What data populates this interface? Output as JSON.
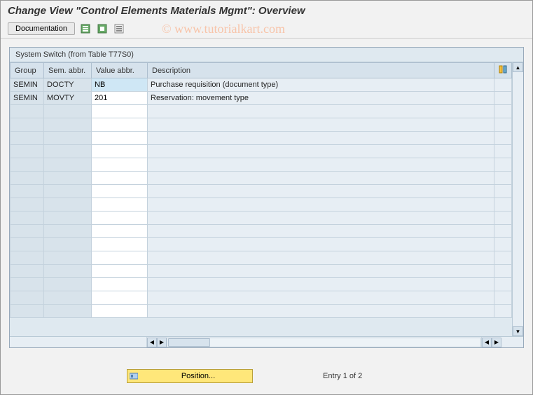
{
  "page_title": "Change View \"Control Elements Materials Mgmt\": Overview",
  "watermark": "© www.tutorialkart.com",
  "toolbar": {
    "documentation_label": "Documentation"
  },
  "grid": {
    "title": "System Switch (from Table T77S0)",
    "headers": {
      "group": "Group",
      "sem": "Sem. abbr.",
      "value": "Value abbr.",
      "desc": "Description"
    },
    "rows": [
      {
        "group": "SEMIN",
        "sem": "DOCTY",
        "value": "NB",
        "desc": "Purchase requisition (document type)",
        "selected": true
      },
      {
        "group": "SEMIN",
        "sem": "MOVTY",
        "value": "201",
        "desc": "Reservation: movement type",
        "selected": false
      }
    ]
  },
  "footer": {
    "position_label": "Position...",
    "entry_text": "Entry 1 of 2"
  }
}
